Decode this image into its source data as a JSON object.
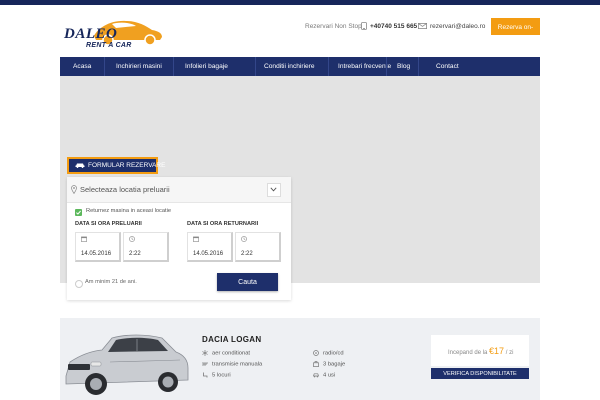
{
  "brand": {
    "logo_line1": "DALEO",
    "logo_line2": "RENT A CAR",
    "accent_color": "#f39c12",
    "navy_color": "#1e2f6b"
  },
  "header": {
    "nonstop_label": "Rezervari Non Stop",
    "phone": "+40740 515 665",
    "email": "rezervari@daleo.ro",
    "reserve_button": "Rezerva on-line",
    "phone_icon": "phone-icon",
    "email_icon": "envelope-icon"
  },
  "nav": {
    "items": [
      {
        "label": "Acasa"
      },
      {
        "label": "Inchirieri masini"
      },
      {
        "label": "Infolieri bagaje"
      },
      {
        "label": "Conditii inchiriere"
      },
      {
        "label": "Intrebari frecvente"
      },
      {
        "label": "Blog"
      },
      {
        "label": "Contact"
      }
    ]
  },
  "form": {
    "tab_label": "FORMULAR REZERVARE",
    "location_placeholder": "Selecteaza locatia preluarii",
    "same_location_label": "Returnez masina in aceasi locatie",
    "same_location_checked": true,
    "pickup_label": "DATA SI ORA PRELUARII",
    "return_label": "DATA SI ORA RETURNARII",
    "pickup_date": "14.05.2016",
    "pickup_time": "2:22",
    "return_date": "14.05.2016",
    "return_time": "2:22",
    "age_label": "Am minim 21 de ani.",
    "search_button": "Cauta"
  },
  "car": {
    "name": "DACIA LOGAN",
    "features_left": [
      {
        "icon": "snowflake-icon",
        "label": "aer conditionat"
      },
      {
        "icon": "gearbox-icon",
        "label": "transmisie manuala"
      },
      {
        "icon": "seat-icon",
        "label": "5 locuri"
      }
    ],
    "features_right": [
      {
        "icon": "radio-icon",
        "label": "radio/cd"
      },
      {
        "icon": "luggage-icon",
        "label": "3 bagaje"
      },
      {
        "icon": "car-door-icon",
        "label": "4 usi"
      }
    ],
    "price_prefix": "Incepand de la",
    "price_amount": "€17",
    "price_suffix": "/ zi",
    "availability_button": "VERIFICA DISPONIBILITATE"
  }
}
